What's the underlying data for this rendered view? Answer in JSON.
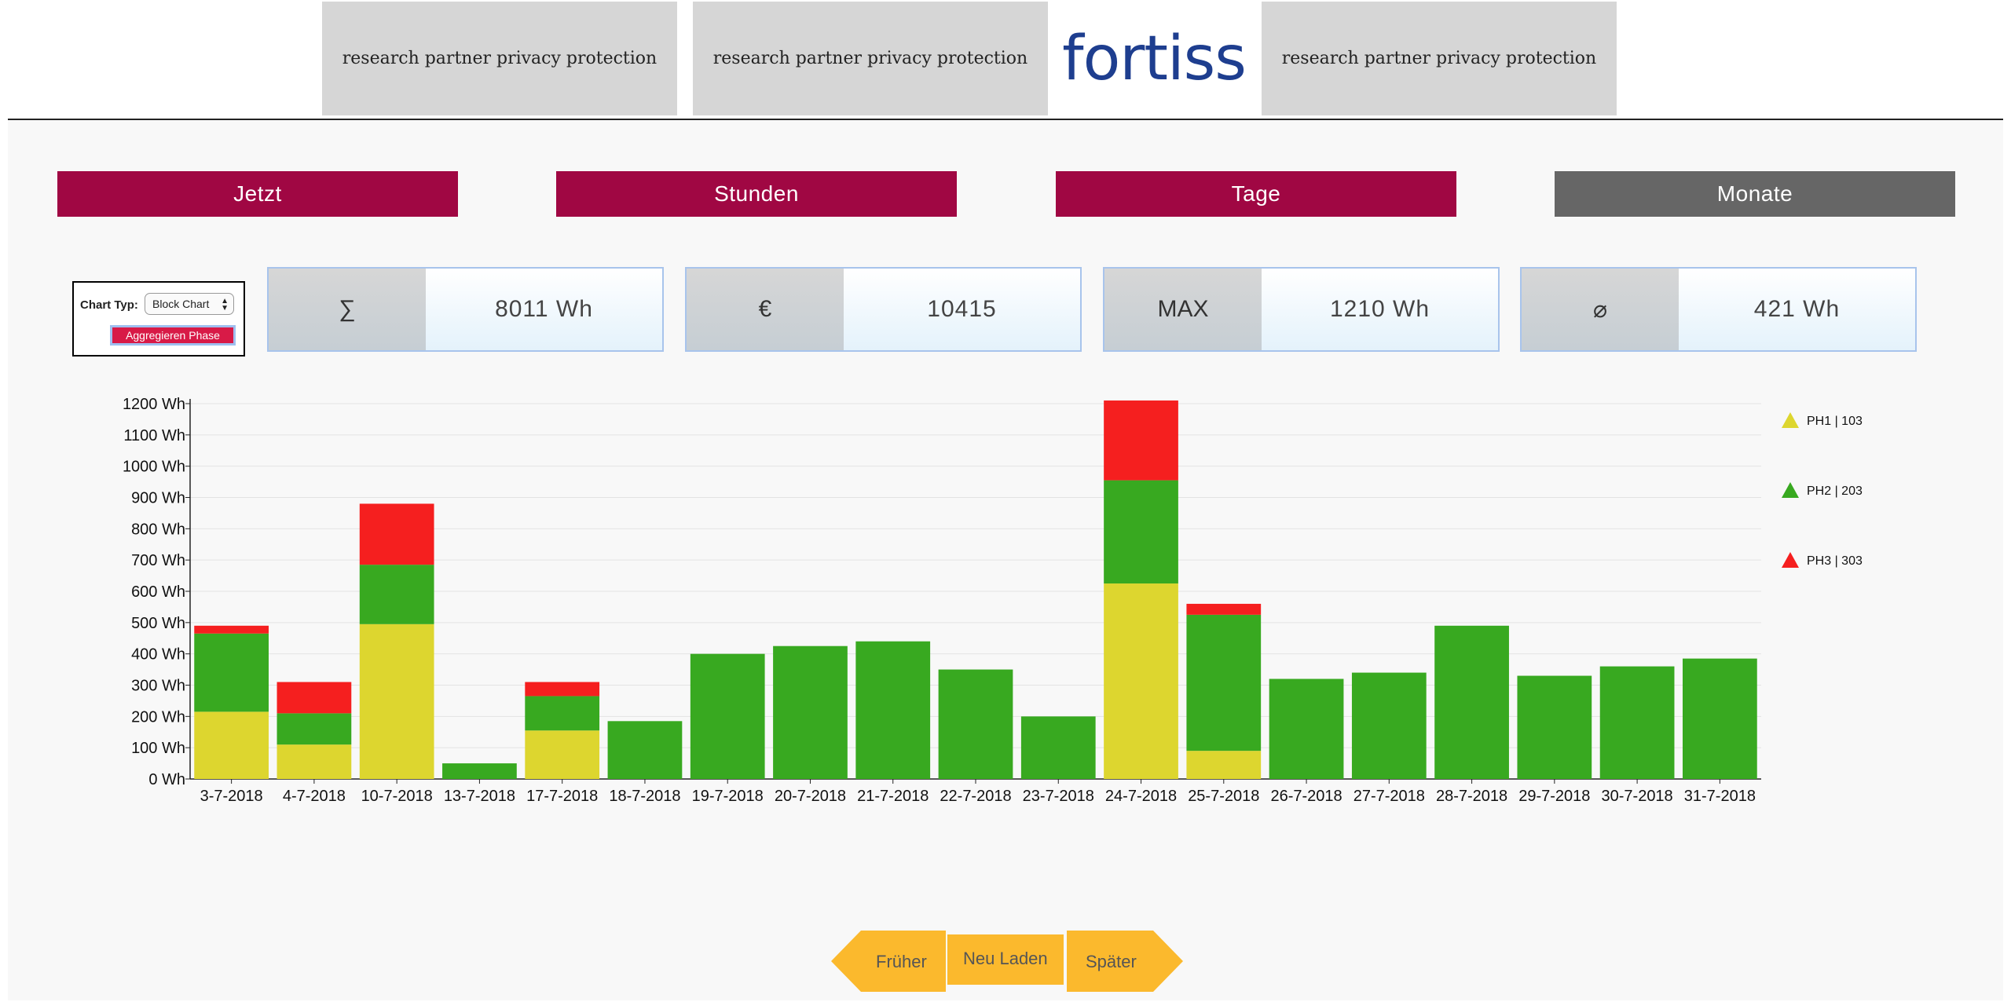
{
  "header": {
    "tiles": [
      "research partner privacy protection",
      "research partner privacy protection",
      "research partner privacy protection"
    ],
    "logo": "fortiss"
  },
  "periods": {
    "jetzt": "Jetzt",
    "stunden": "Stunden",
    "tage": "Tage",
    "monate": "Monate"
  },
  "controls": {
    "chart_type_label": "Chart Typ:",
    "chart_type_value": "Block Chart",
    "aggregate_button": "Aggregieren Phase"
  },
  "stats": {
    "sum_symbol": "∑",
    "sum_value": "8011 Wh",
    "cost_symbol": "€",
    "cost_value": "10415",
    "max_symbol": "MAX",
    "max_value": "1210 Wh",
    "avg_symbol": "⌀",
    "avg_value": "421 Wh"
  },
  "colors": {
    "accent": "#a00743",
    "inactive": "#666666",
    "ph1": "#ddd62f",
    "ph2": "#38a920",
    "ph3": "#f51f1f",
    "nav": "#fbb92d"
  },
  "chart_data": {
    "type": "bar",
    "stacked": true,
    "categories": [
      "3-7-2018",
      "4-7-2018",
      "10-7-2018",
      "13-7-2018",
      "17-7-2018",
      "18-7-2018",
      "19-7-2018",
      "20-7-2018",
      "21-7-2018",
      "22-7-2018",
      "23-7-2018",
      "24-7-2018",
      "25-7-2018",
      "26-7-2018",
      "27-7-2018",
      "28-7-2018",
      "29-7-2018",
      "30-7-2018",
      "31-7-2018"
    ],
    "series": [
      {
        "name": "PH1 | 103",
        "color": "#ddd62f",
        "values": [
          215,
          110,
          495,
          0,
          155,
          0,
          0,
          0,
          0,
          0,
          0,
          625,
          90,
          0,
          0,
          0,
          0,
          0,
          0
        ]
      },
      {
        "name": "PH2 | 203",
        "color": "#38a920",
        "values": [
          250,
          100,
          190,
          50,
          110,
          185,
          400,
          425,
          440,
          350,
          200,
          330,
          435,
          320,
          340,
          490,
          330,
          360,
          385
        ]
      },
      {
        "name": "PH3 | 303",
        "color": "#f51f1f",
        "values": [
          25,
          100,
          195,
          0,
          45,
          0,
          0,
          0,
          0,
          0,
          0,
          255,
          35,
          0,
          0,
          0,
          0,
          0,
          0
        ]
      }
    ],
    "y_ticks": [
      "0 Wh",
      "100 Wh",
      "200 Wh",
      "300 Wh",
      "400 Wh",
      "500 Wh",
      "600 Wh",
      "700 Wh",
      "800 Wh",
      "900 Wh",
      "1000 Wh",
      "1100 Wh",
      "1200 Wh"
    ],
    "ylim": [
      0,
      1200
    ],
    "grid": true,
    "legend_position": "right"
  },
  "nav": {
    "earlier": "Früher",
    "reload": "Neu Laden",
    "later": "Später"
  }
}
